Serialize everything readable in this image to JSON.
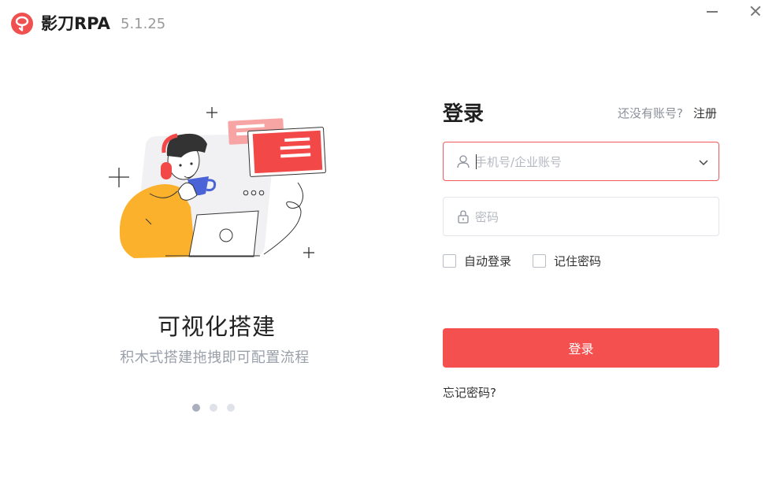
{
  "app": {
    "name": "影刀RPA",
    "version": "5.1.25",
    "brand_color": "#f05050"
  },
  "window_controls": {
    "minimize_icon": "minimize-icon",
    "close_icon": "close-icon"
  },
  "carousel": {
    "title": "可视化搭建",
    "subtitle": "积木式搭建拖拽即可配置流程",
    "slide_count": 3,
    "active_index": 0
  },
  "login": {
    "title": "登录",
    "no_account_text": "还没有账号?",
    "register_label": "注册",
    "username": {
      "placeholder": "手机号/企业账号",
      "value": "",
      "icon": "user-icon",
      "dropdown_icon": "chevron-down-icon"
    },
    "password": {
      "placeholder": "密码",
      "value": "",
      "icon": "lock-icon"
    },
    "auto_login_label": "自动登录",
    "auto_login_checked": false,
    "remember_password_label": "记住密码",
    "remember_password_checked": false,
    "submit_label": "登录",
    "forgot_password_label": "忘记密码?",
    "button_color": "#f55050"
  }
}
